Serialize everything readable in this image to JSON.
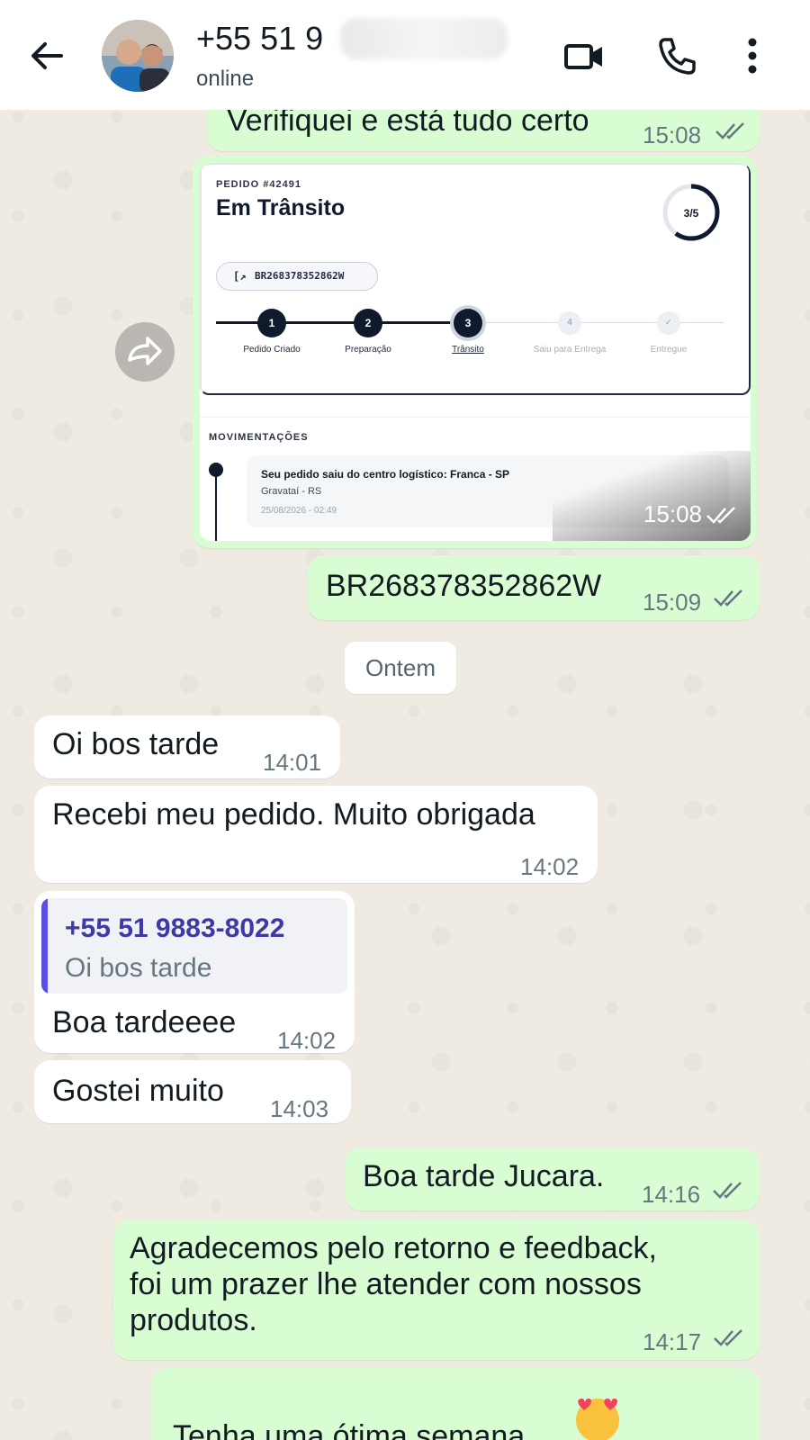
{
  "header": {
    "contact_name": "+55 51 9",
    "status": "online",
    "back_icon": "arrow-left-icon",
    "video_icon": "video-call-icon",
    "call_icon": "phone-icon",
    "menu_icon": "more-vertical-icon"
  },
  "messages": {
    "m1": {
      "text": "Verifiquei e está tudo certo",
      "time": "15:08",
      "direction": "out",
      "read": true
    },
    "image": {
      "time": "15:08",
      "order_label": "PEDIDO #42491",
      "status_title": "Em Trânsito",
      "progress_text": "3/5",
      "progress_fraction": 0.6,
      "tracking_code": "BR268378352862W",
      "steps": [
        {
          "num": "1",
          "label": "Pedido Criado",
          "state": "done"
        },
        {
          "num": "2",
          "label": "Preparação",
          "state": "done"
        },
        {
          "num": "3",
          "label": "Trânsito",
          "state": "current"
        },
        {
          "num": "4",
          "label": "Saiu para Entrega",
          "state": "todo"
        },
        {
          "num": "✓",
          "label": "Entregue",
          "state": "todo"
        }
      ],
      "movements_title": "MOVIMENTAÇÕES",
      "movement": {
        "text": "Seu pedido saiu do centro logístico: Franca - SP",
        "place": "Gravataí - RS",
        "date": "25/08/2026 - 02:49"
      }
    },
    "m2": {
      "text": "BR268378352862W",
      "time": "15:09",
      "direction": "out",
      "read": true
    },
    "date_separator": "Ontem",
    "m3": {
      "text": "Oi bos tarde",
      "time": "14:01",
      "direction": "in"
    },
    "m4": {
      "text": "Recebi meu pedido. Muito obrigada",
      "time": "14:02",
      "direction": "in"
    },
    "m5": {
      "quote_name": "+55 51 9883-8022",
      "quote_text": "Oi bos tarde",
      "text": "Boa tardeeee",
      "time": "14:02",
      "direction": "in"
    },
    "m6": {
      "text": "Gostei muito",
      "time": "14:03",
      "direction": "in"
    },
    "m7": {
      "text": "Boa tarde Jucara.",
      "time": "14:16",
      "direction": "out",
      "read": true
    },
    "m8": {
      "line1": "Agradecemos pelo retorno e feedback,",
      "line2": "foi um prazer lhe atender com nossos",
      "line3": "produtos.",
      "time": "14:17",
      "direction": "out",
      "read": true
    },
    "m9": {
      "text": "Tenha uma ótima semana",
      "emoji": "smiling-face-with-hearts-emoji",
      "direction": "out"
    }
  },
  "colors": {
    "outgoing_bubble": "#d9fdd3",
    "incoming_bubble": "#ffffff",
    "read_ticks": "#667781",
    "quote_accent": "#5b4ee0",
    "order_navy": "#0f1b2d"
  }
}
